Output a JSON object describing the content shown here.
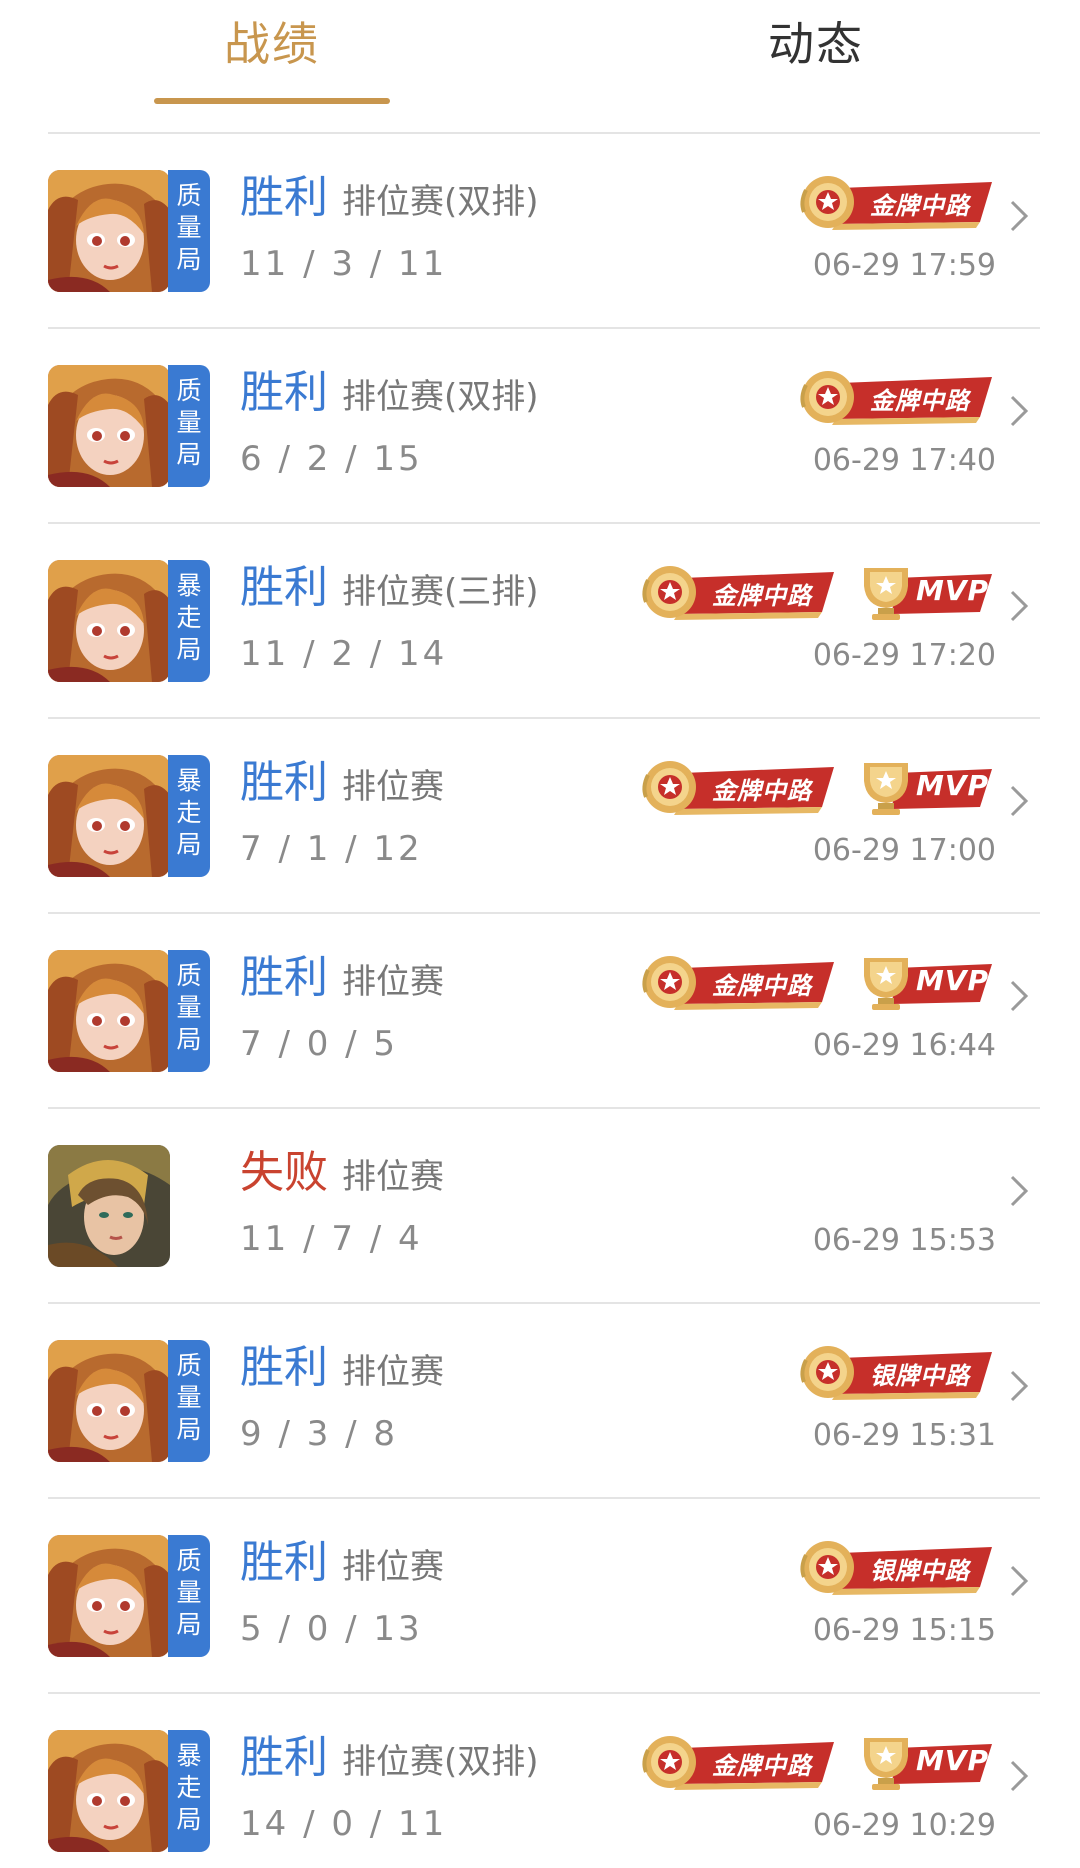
{
  "tabs": [
    {
      "label": "战绩",
      "active": true
    },
    {
      "label": "动态",
      "active": false
    }
  ],
  "colors": {
    "accent": "#c8964e",
    "win": "#3a7ad2",
    "loss": "#c9432f",
    "tag_bg": "#3a7ad2",
    "badge_red": "#c62f2a",
    "badge_gold": "#e3b15a"
  },
  "matches": [
    {
      "result": "胜利",
      "outcome": "win",
      "mode": "排位赛(双排)",
      "kda": "11 / 3 / 11",
      "time": "06-29 17:59",
      "hero": "hero-a",
      "tag": [
        "质",
        "量",
        "局"
      ],
      "badges": [
        {
          "type": "medal",
          "label": "金牌中路"
        }
      ]
    },
    {
      "result": "胜利",
      "outcome": "win",
      "mode": "排位赛(双排)",
      "kda": "6 / 2 / 15",
      "time": "06-29 17:40",
      "hero": "hero-a",
      "tag": [
        "质",
        "量",
        "局"
      ],
      "badges": [
        {
          "type": "medal",
          "label": "金牌中路"
        }
      ]
    },
    {
      "result": "胜利",
      "outcome": "win",
      "mode": "排位赛(三排)",
      "kda": "11 / 2 / 14",
      "time": "06-29 17:20",
      "hero": "hero-a",
      "tag": [
        "暴",
        "走",
        "局"
      ],
      "badges": [
        {
          "type": "medal",
          "label": "金牌中路"
        },
        {
          "type": "mvp",
          "label": "MVP"
        }
      ]
    },
    {
      "result": "胜利",
      "outcome": "win",
      "mode": "排位赛",
      "kda": "7 / 1 / 12",
      "time": "06-29 17:00",
      "hero": "hero-a",
      "tag": [
        "暴",
        "走",
        "局"
      ],
      "badges": [
        {
          "type": "medal",
          "label": "金牌中路"
        },
        {
          "type": "mvp",
          "label": "MVP"
        }
      ]
    },
    {
      "result": "胜利",
      "outcome": "win",
      "mode": "排位赛",
      "kda": "7 / 0 / 5",
      "time": "06-29 16:44",
      "hero": "hero-a",
      "tag": [
        "质",
        "量",
        "局"
      ],
      "badges": [
        {
          "type": "medal",
          "label": "金牌中路"
        },
        {
          "type": "mvp",
          "label": "MVP"
        }
      ]
    },
    {
      "result": "失败",
      "outcome": "loss",
      "mode": "排位赛",
      "kda": "11 / 7 / 4",
      "time": "06-29 15:53",
      "hero": "hero-b",
      "tag": [],
      "badges": []
    },
    {
      "result": "胜利",
      "outcome": "win",
      "mode": "排位赛",
      "kda": "9 / 3 / 8",
      "time": "06-29 15:31",
      "hero": "hero-a",
      "tag": [
        "质",
        "量",
        "局"
      ],
      "badges": [
        {
          "type": "medal",
          "label": "银牌中路"
        }
      ]
    },
    {
      "result": "胜利",
      "outcome": "win",
      "mode": "排位赛",
      "kda": "5 / 0 / 13",
      "time": "06-29 15:15",
      "hero": "hero-a",
      "tag": [
        "质",
        "量",
        "局"
      ],
      "badges": [
        {
          "type": "medal",
          "label": "银牌中路"
        }
      ]
    },
    {
      "result": "胜利",
      "outcome": "win",
      "mode": "排位赛(双排)",
      "kda": "14 / 0 / 11",
      "time": "06-29 10:29",
      "hero": "hero-a",
      "tag": [
        "暴",
        "走",
        "局"
      ],
      "badges": [
        {
          "type": "medal",
          "label": "金牌中路"
        },
        {
          "type": "mvp",
          "label": "MVP"
        }
      ]
    }
  ]
}
